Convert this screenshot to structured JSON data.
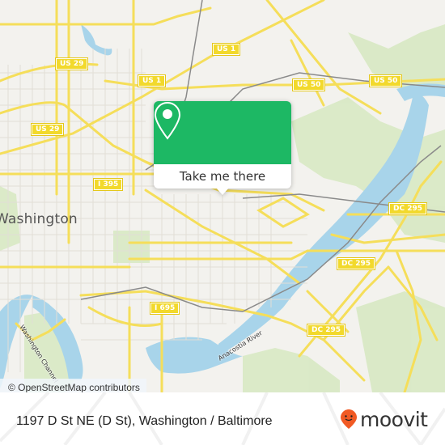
{
  "map": {
    "city_label": "Washington",
    "water_labels": [
      "Washington Channel",
      "Anacostia River"
    ],
    "route_shields": [
      {
        "label": "US 29"
      },
      {
        "label": "US 29"
      },
      {
        "label": "US 1"
      },
      {
        "label": "US 1"
      },
      {
        "label": "US 50"
      },
      {
        "label": "US 50"
      },
      {
        "label": "I 395"
      },
      {
        "label": "I 695"
      },
      {
        "label": "DC 295"
      },
      {
        "label": "DC 295"
      },
      {
        "label": "DC 295"
      }
    ],
    "attribution": "© OpenStreetMap contributors"
  },
  "popup": {
    "icon": "map-pin-icon",
    "button_label": "Take me there",
    "accent_color": "#1db864"
  },
  "footer": {
    "address": "1197 D St NE (D St), Washington / Baltimore",
    "brand": "moovit",
    "brand_icon": "moovit-smiley-pin-icon",
    "brand_color": "#f15a24"
  }
}
